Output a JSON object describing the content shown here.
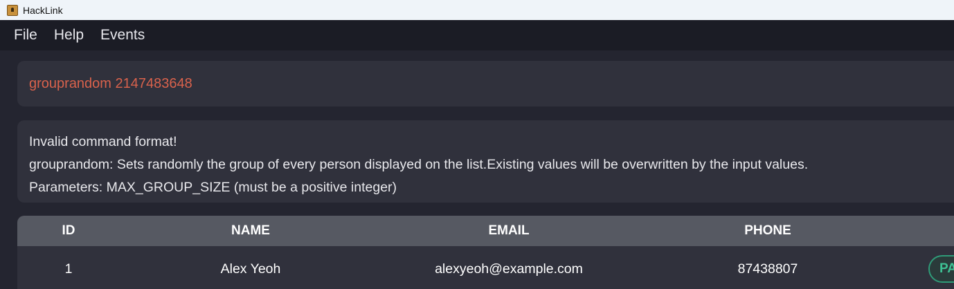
{
  "window": {
    "title": "HackLink"
  },
  "menu": {
    "file": "File",
    "help": "Help",
    "events": "Events"
  },
  "command": {
    "text": "grouprandom 2147483648"
  },
  "result": {
    "lines": [
      "Invalid command format!",
      "grouprandom: Sets randomly the group of every person displayed on the list.Existing values will be overwritten by the input values.",
      "Parameters: MAX_GROUP_SIZE (must be a positive integer)"
    ]
  },
  "table": {
    "headers": {
      "id": "ID",
      "name": "NAME",
      "email": "EMAIL",
      "phone": "PHONE"
    },
    "rows": [
      {
        "id": "1",
        "name": "Alex Yeoh",
        "email": "alexyeoh@example.com",
        "phone": "87438807",
        "tag": "PA"
      }
    ]
  },
  "colors": {
    "command_text": "#d9624c",
    "tag_border": "#2f9b78",
    "tag_text": "#3ec093"
  }
}
